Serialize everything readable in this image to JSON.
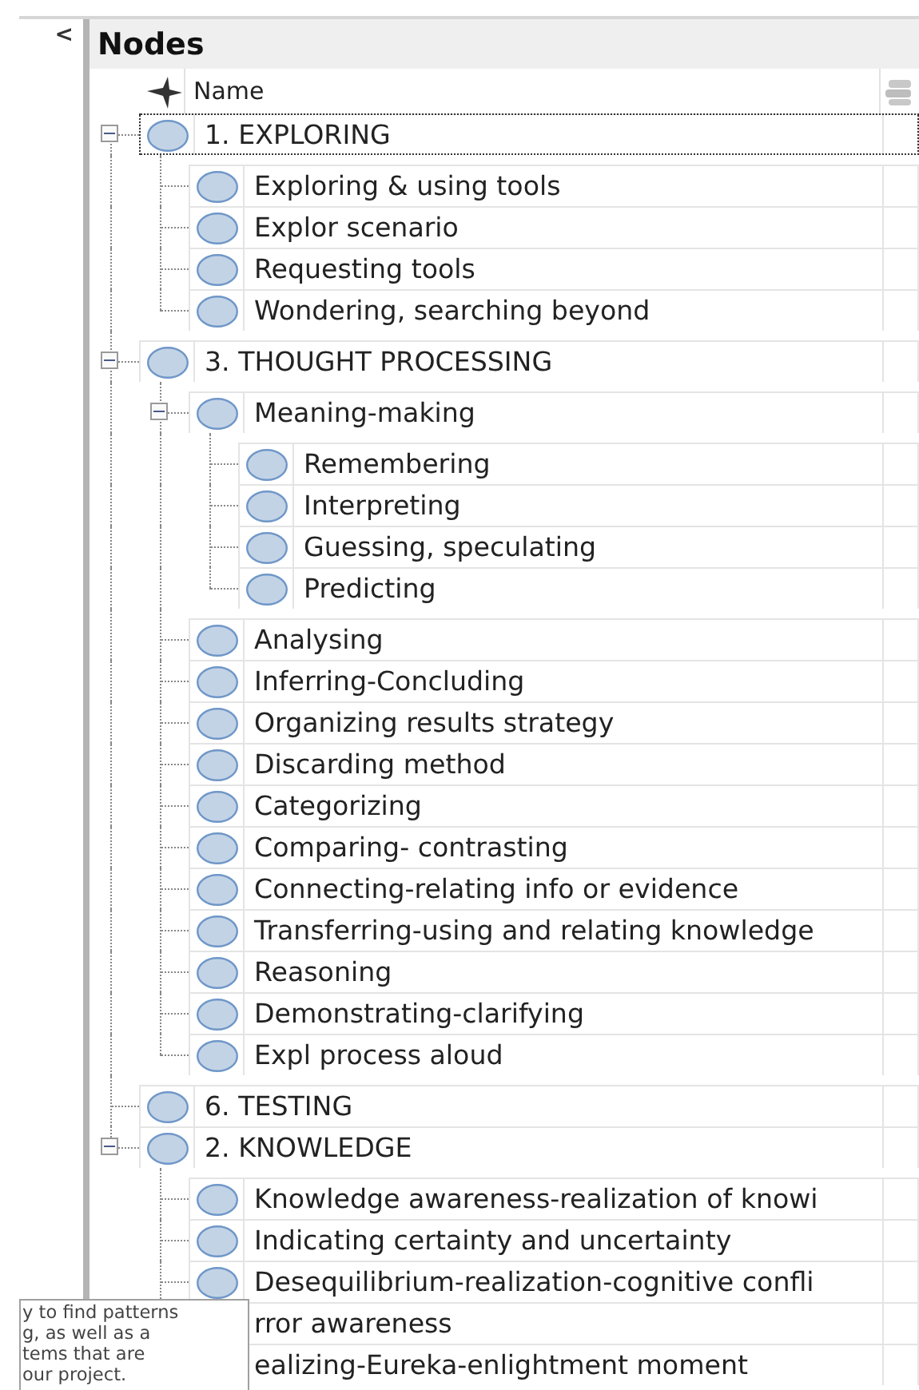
{
  "collapse_button": "<",
  "panel": {
    "title": "Nodes"
  },
  "table": {
    "columns": [
      {
        "label": "Name"
      }
    ],
    "rows": [
      {
        "name": "1. EXPLORING",
        "selected": true,
        "expanded": true,
        "children": [
          {
            "name": "Exploring & using tools",
            "selected": false
          },
          {
            "name": "Explor scenario",
            "selected": false
          },
          {
            "name": "Requesting tools",
            "selected": false
          },
          {
            "name": "Wondering, searching beyond",
            "selected": false
          }
        ]
      },
      {
        "name": "3. THOUGHT PROCESSING",
        "selected": false,
        "expanded": true,
        "children": [
          {
            "name": "Meaning-making",
            "selected": false,
            "expanded": true,
            "children": [
              {
                "name": "Remembering",
                "selected": false
              },
              {
                "name": "Interpreting",
                "selected": false
              },
              {
                "name": "Guessing, speculating",
                "selected": false
              },
              {
                "name": "Predicting",
                "selected": false
              }
            ]
          },
          {
            "name": "Analysing",
            "selected": false
          },
          {
            "name": "Inferring-Concluding",
            "selected": false
          },
          {
            "name": "Organizing results strategy",
            "selected": false
          },
          {
            "name": "Discarding method",
            "selected": false
          },
          {
            "name": "Categorizing",
            "selected": false
          },
          {
            "name": "Comparing- contrasting",
            "selected": false
          },
          {
            "name": "Connecting-relating info or evidence",
            "selected": false
          },
          {
            "name": "Transferring-using and relating knowledge",
            "selected": false
          },
          {
            "name": "Reasoning",
            "selected": false
          },
          {
            "name": "Demonstrating-clarifying",
            "selected": false
          },
          {
            "name": "Expl process aloud",
            "selected": false
          }
        ]
      },
      {
        "name": "6. TESTING",
        "selected": false
      },
      {
        "name": "2. KNOWLEDGE",
        "selected": false,
        "expanded": true,
        "children": [
          {
            "name": "Knowledge awareness-realization of knowi",
            "selected": false
          },
          {
            "name": "Indicating certainty and uncertainty",
            "selected": false
          },
          {
            "name": "Desequilibrium-realization-cognitive confli",
            "selected": false
          },
          {
            "name": "rror awareness",
            "selected": false
          },
          {
            "name": "ealizing-Eureka-enlightment moment",
            "selected": false
          }
        ]
      }
    ]
  },
  "tooltip": {
    "lines": [
      "y to find patterns",
      "g, as well as a",
      "tems that are",
      "our project."
    ]
  }
}
